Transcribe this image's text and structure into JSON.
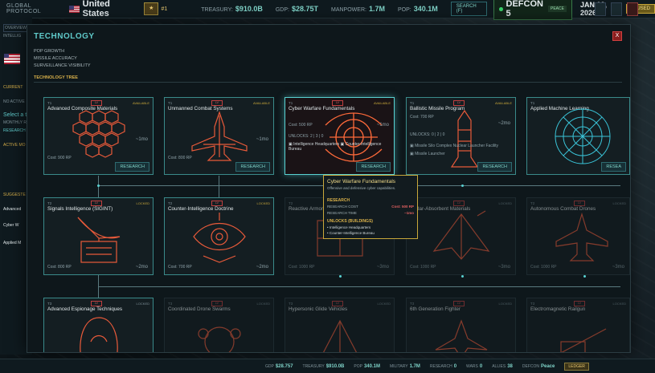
{
  "topbar": {
    "protocol": "GLOBAL PROTOCOL",
    "country": "United States",
    "rank": "#1",
    "treasury_label": "TREASURY:",
    "treasury": "$910.0B",
    "gdp_label": "GDP:",
    "gdp": "$28.75T",
    "manpower_label": "MANPOWER:",
    "manpower": "1.7M",
    "pop_label": "POP:",
    "pop": "340.1M",
    "search_label": "SEARCH (F)",
    "defcon_label": "DEFCON 5",
    "defcon_state": "PEACE",
    "date": "JAN 02, 2026",
    "paused_label": "PAUSED"
  },
  "lefthud": {
    "overview": "OVERVIEW",
    "intel": "INTELLIG",
    "current": "CURRENT",
    "no_active": "NO ACTIVE",
    "select": "Select a t",
    "monthly": "MONTHLY R",
    "research": "RESEARCH",
    "active_mod": "ACTIVE MO",
    "suggested": "SUGGESTE",
    "s1": "Advanced",
    "s2": "Cyber W",
    "s3": "Applied M"
  },
  "modal": {
    "title": "TECHNOLOGY",
    "close_label": "X",
    "metrics": [
      "POP GROWTH",
      "MISSILE ACCURACY",
      "SURVEILLANCE VISIBILITY"
    ],
    "tree_label": "TECHNOLOGY TREE"
  },
  "cards": [
    {
      "tier": "T1",
      "name": "Advanced Composite Materials",
      "status": "AVAILABLE",
      "cost": "Cost: 900 RP",
      "time": "~1mo",
      "button": "RESEARCH"
    },
    {
      "tier": "T1",
      "name": "Unmanned Combat Systems",
      "status": "AVAILABLE",
      "cost": "Cost: 800 RP",
      "time": "~1mo",
      "button": "RESEARCH"
    },
    {
      "tier": "T1",
      "name": "Cyber Warfare Fundamentals",
      "status": "AVAILABLE",
      "cost": "Cost: 500 RP",
      "time": "~1mo",
      "unlocks": "UNLOCKS: 2 | 3 | 0",
      "unlock1": "Intelligence Headquarters",
      "unlock2": "Counter-Intelligence Bureau",
      "button": "RESEARCH"
    },
    {
      "tier": "T1",
      "name": "Ballistic Missile Program",
      "status": "AVAILABLE",
      "cost": "Cost: 700 RP",
      "time": "~2mo",
      "unlocks": "UNLOCKS: 0 | 2 | 0",
      "unlock1": "Missile Silo Complex",
      "unlock2": "Nuclear Launcher Facility",
      "unlock3": "Missile Launcher",
      "button": "RESEARCH"
    },
    {
      "tier": "T1",
      "name": "Applied Machine Learning",
      "status": "AVAILABLE",
      "cost": "",
      "time": "",
      "button": "RESEA"
    },
    {
      "tier": "T2",
      "name": "Signals Intelligence (SIGINT)",
      "status": "LOCKED",
      "cost": "Cost: 800 RP",
      "time": "~2mo"
    },
    {
      "tier": "T2",
      "name": "Counter-Intelligence Doctrine",
      "status": "LOCKED",
      "cost": "Cost: 700 RP",
      "time": "~2mo"
    },
    {
      "tier": "T2",
      "name": "Reactive Armor",
      "status": "LOCKED",
      "cost": "Cost: 1000 RP",
      "time": "~3mo"
    },
    {
      "tier": "T2",
      "name": "Radar-Absorbent Materials",
      "status": "LOCKED",
      "cost": "Cost: 1000 RP",
      "time": "~3mo"
    },
    {
      "tier": "T2",
      "name": "Autonomous Combat Drones",
      "status": "LOCKED",
      "cost": "Cost: 1000 RP",
      "time": "~3mo"
    },
    {
      "tier": "T3",
      "name": "Advanced Espionage Techniques",
      "status": "LOCKED"
    },
    {
      "tier": "T3",
      "name": "Coordinated Drone Swarms",
      "status": "LOCKED"
    },
    {
      "tier": "T3",
      "name": "Hypersonic Glide Vehicles",
      "status": "LOCKED"
    },
    {
      "tier": "T3",
      "name": "6th Generation Fighter",
      "status": "LOCKED"
    },
    {
      "tier": "T3",
      "name": "Electromagnetic Railgun",
      "status": "LOCKED"
    }
  ],
  "tooltip": {
    "title": "Cyber Warfare Fundamentals",
    "desc": "Offensive and defensive cyber capabilities.",
    "research_label": "RESEARCH",
    "cost_label": "RESEARCH COST",
    "cost_value": "Cost: 500 RP",
    "time_label": "RESEARCH TIME",
    "time_value": "~1mo",
    "unlocks_label": "UNLOCKS (BUILDINGS)",
    "u1": "• Intelligence Headquarters",
    "u2": "• Counter-Intelligence Bureau"
  },
  "bottombar": {
    "gdp_label": "GDP",
    "gdp": "$28.757",
    "treasury_label": "TREASURY",
    "treasury": "$910.0B",
    "pop_label": "POP",
    "pop": "340.1M",
    "military_label": "MILITARY",
    "military": "1.7M",
    "research_label": "RESEARCH",
    "research": "0",
    "wars_label": "WARS",
    "wars": "0",
    "allies_label": "ALLIES",
    "allies": "38",
    "defcon_label": "DEFCON",
    "defcon": "Peace",
    "ledger": "LEDGER"
  },
  "colors": {
    "accent": "#59d2d2",
    "gold": "#c9a83a",
    "alert": "#e06060",
    "art": "#e85a3a"
  }
}
